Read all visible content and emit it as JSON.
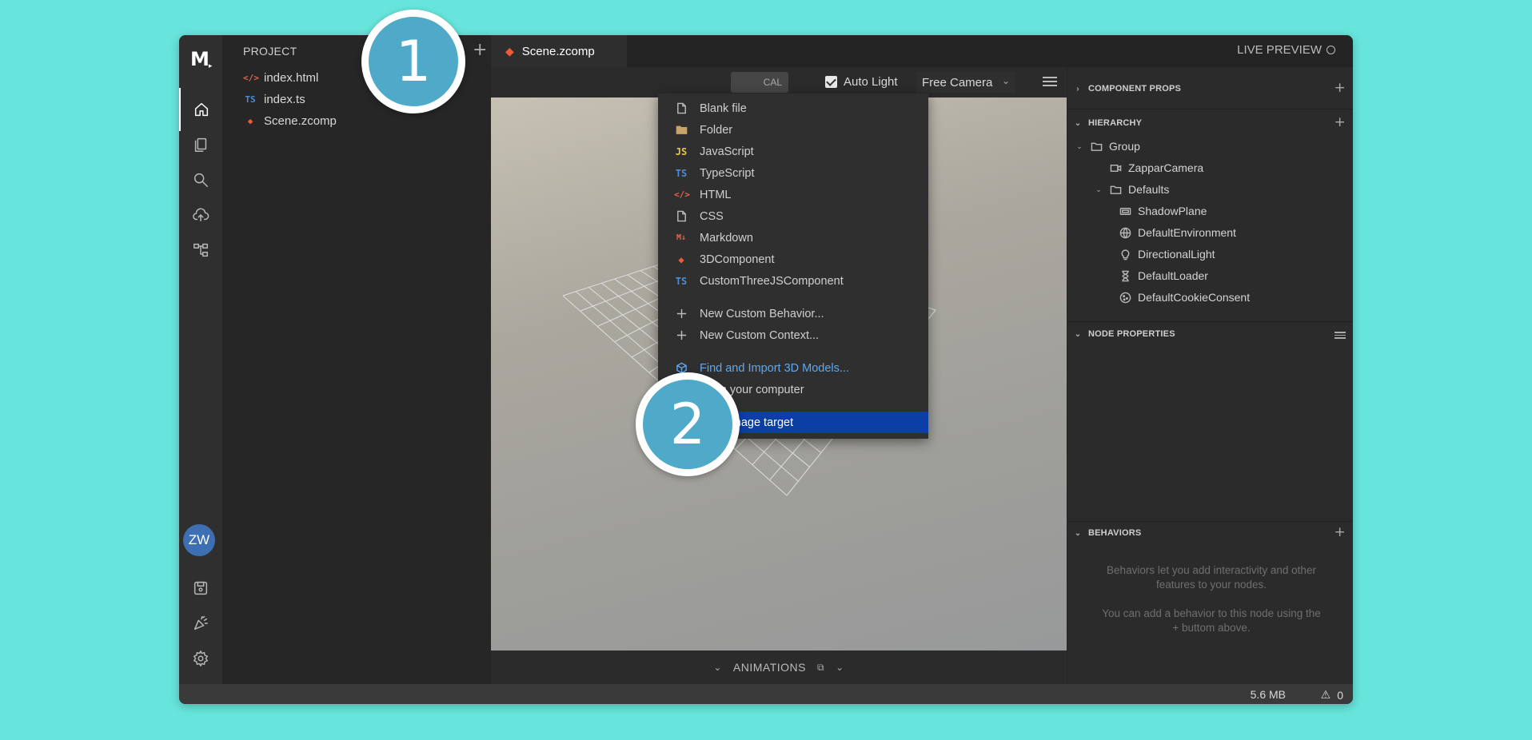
{
  "app": {
    "logo": "M",
    "logo_mark": "▸"
  },
  "project": {
    "title": "PROJECT",
    "add_label": "+",
    "files": [
      {
        "name": "index.html",
        "icon": "</>",
        "icon_color": "#e4674a"
      },
      {
        "name": "index.ts",
        "icon": "TS",
        "icon_color": "#4b8ed6"
      },
      {
        "name": "Scene.zcomp",
        "icon": "zcomp-icon",
        "icon_color": "#ef5b36"
      }
    ]
  },
  "tabs": {
    "active_tab": "Scene.zcomp",
    "live_preview": "LIVE PREVIEW"
  },
  "viewport_toolbar": {
    "local_label": "CAL",
    "auto_light_label": "Auto Light",
    "auto_light_checked": true,
    "camera_value": "Free Camera"
  },
  "animations": {
    "label": "ANIMATIONS"
  },
  "right_panel": {
    "component_props": "COMPONENT PROPS",
    "hierarchy": "HIERARCHY",
    "nodes": [
      {
        "name": "Group",
        "icon": "folder-icon",
        "level": 0,
        "expanded": true
      },
      {
        "name": "ZapparCamera",
        "icon": "camera-icon",
        "level": 1
      },
      {
        "name": "Defaults",
        "icon": "folder-icon",
        "level": 1,
        "expanded": true
      },
      {
        "name": "ShadowPlane",
        "icon": "plane-icon",
        "level": 2
      },
      {
        "name": "DefaultEnvironment",
        "icon": "globe-icon",
        "level": 2
      },
      {
        "name": "DirectionalLight",
        "icon": "bulb-icon",
        "level": 2
      },
      {
        "name": "DefaultLoader",
        "icon": "hourglass-icon",
        "level": 2
      },
      {
        "name": "DefaultCookieConsent",
        "icon": "cookie-icon",
        "level": 2
      }
    ],
    "node_properties": "NODE PROPERTIES",
    "behaviors": "BEHAVIORS",
    "behaviors_text_1": "Behaviors let you add interactivity and other features to your nodes.",
    "behaviors_text_2": "You can add a behavior to this node using the + buttom above."
  },
  "status": {
    "size": "5.6 MB",
    "warnings": "0"
  },
  "dropdown": {
    "items": [
      {
        "label": "Blank file",
        "icon": "file-icon",
        "color": "#bdbdbd"
      },
      {
        "label": "Folder",
        "icon": "folder-filled-icon",
        "color": "#c8a36a"
      },
      {
        "label": "JavaScript",
        "icon": "JS",
        "color": "#e8c94a"
      },
      {
        "label": "TypeScript",
        "icon": "TS",
        "color": "#4b8ed6"
      },
      {
        "label": "HTML",
        "icon": "</>",
        "color": "#e4674a"
      },
      {
        "label": "CSS",
        "icon": "file-icon",
        "color": "#bdbdbd"
      },
      {
        "label": "Markdown",
        "icon": "M↓",
        "color": "#e4674a"
      },
      {
        "label": "3DComponent",
        "icon": "zcomp-icon",
        "color": "#ef5b36"
      },
      {
        "label": "CustomThreeJSComponent",
        "icon": "TS",
        "color": "#4b8ed6"
      },
      {
        "label": "New Custom Behavior...",
        "icon": "plus-icon",
        "color": "#bdbdbd"
      },
      {
        "label": "New Custom Context...",
        "icon": "plus-icon",
        "color": "#bdbdbd"
      },
      {
        "label": "Find and Import 3D Models...",
        "icon": "cube-icon",
        "color": "#5ea8ef"
      },
      {
        "label": "From your computer",
        "icon": "upload-icon",
        "color": "#bdbdbd"
      },
      {
        "label": "Train image target",
        "icon": "image-target-icon",
        "color": "#ffffff"
      }
    ]
  },
  "callouts": {
    "one": "1",
    "two": "2"
  },
  "avatar": "ZW"
}
